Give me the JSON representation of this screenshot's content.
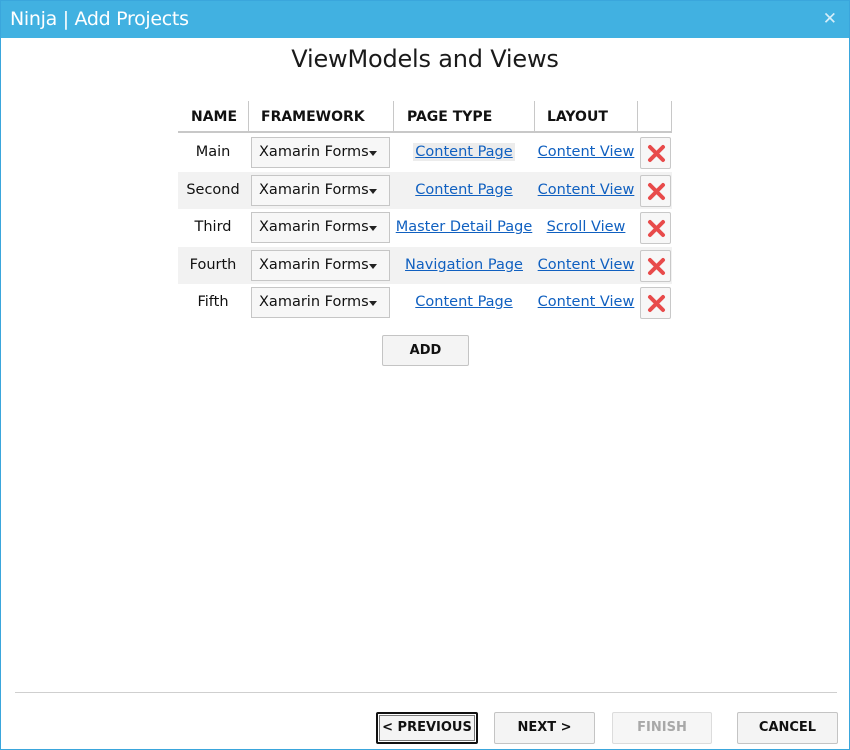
{
  "window": {
    "title": "Ninja | Add Projects",
    "close_glyph": "✕"
  },
  "page": {
    "heading": "ViewModels and Views"
  },
  "table": {
    "columns": [
      "NAME",
      "FRAMEWORK",
      "PAGE TYPE",
      "LAYOUT"
    ],
    "rows": [
      {
        "name": "Main",
        "framework": "Xamarin Forms",
        "page_type": "Content Page",
        "layout": "Content View"
      },
      {
        "name": "Second",
        "framework": "Xamarin Forms",
        "page_type": "Content Page",
        "layout": "Content View"
      },
      {
        "name": "Third",
        "framework": "Xamarin Forms",
        "page_type": "Master Detail Page",
        "layout": "Scroll View"
      },
      {
        "name": "Fourth",
        "framework": "Xamarin Forms",
        "page_type": "Navigation Page",
        "layout": "Content View"
      },
      {
        "name": "Fifth",
        "framework": "Xamarin Forms",
        "page_type": "Content Page",
        "layout": "Content View"
      }
    ],
    "add_label": "ADD"
  },
  "footer": {
    "previous_label": "< PREVIOUS",
    "next_label": "NEXT >",
    "finish_label": "FINISH",
    "cancel_label": "CANCEL"
  },
  "colors": {
    "titlebar": "#41b1e1",
    "link": "#1060c0",
    "delete_icon": "#e84a4a"
  },
  "icons": {
    "delete": "delete-x-icon",
    "dropdown": "dropdown-arrow-icon",
    "close": "close-icon"
  }
}
